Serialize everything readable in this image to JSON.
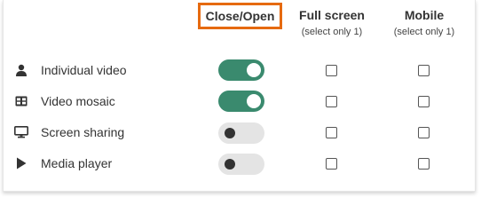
{
  "columns": {
    "close_open": {
      "title": "Close/Open"
    },
    "full_screen": {
      "title": "Full screen",
      "subtitle": "(select only 1)"
    },
    "mobile": {
      "title": "Mobile",
      "subtitle": "(select only 1)"
    }
  },
  "rows": [
    {
      "icon": "user-icon",
      "label": "Individual video",
      "enabled": true,
      "full_screen": false,
      "mobile": false
    },
    {
      "icon": "grid-icon",
      "label": "Video mosaic",
      "enabled": true,
      "full_screen": false,
      "mobile": false
    },
    {
      "icon": "monitor-icon",
      "label": "Screen sharing",
      "enabled": false,
      "full_screen": false,
      "mobile": false
    },
    {
      "icon": "play-icon",
      "label": "Media player",
      "enabled": false,
      "full_screen": false,
      "mobile": false
    }
  ],
  "colors": {
    "highlight_border": "#e66a10",
    "toggle_on": "#3a8a6e",
    "toggle_off": "#e4e4e4"
  }
}
